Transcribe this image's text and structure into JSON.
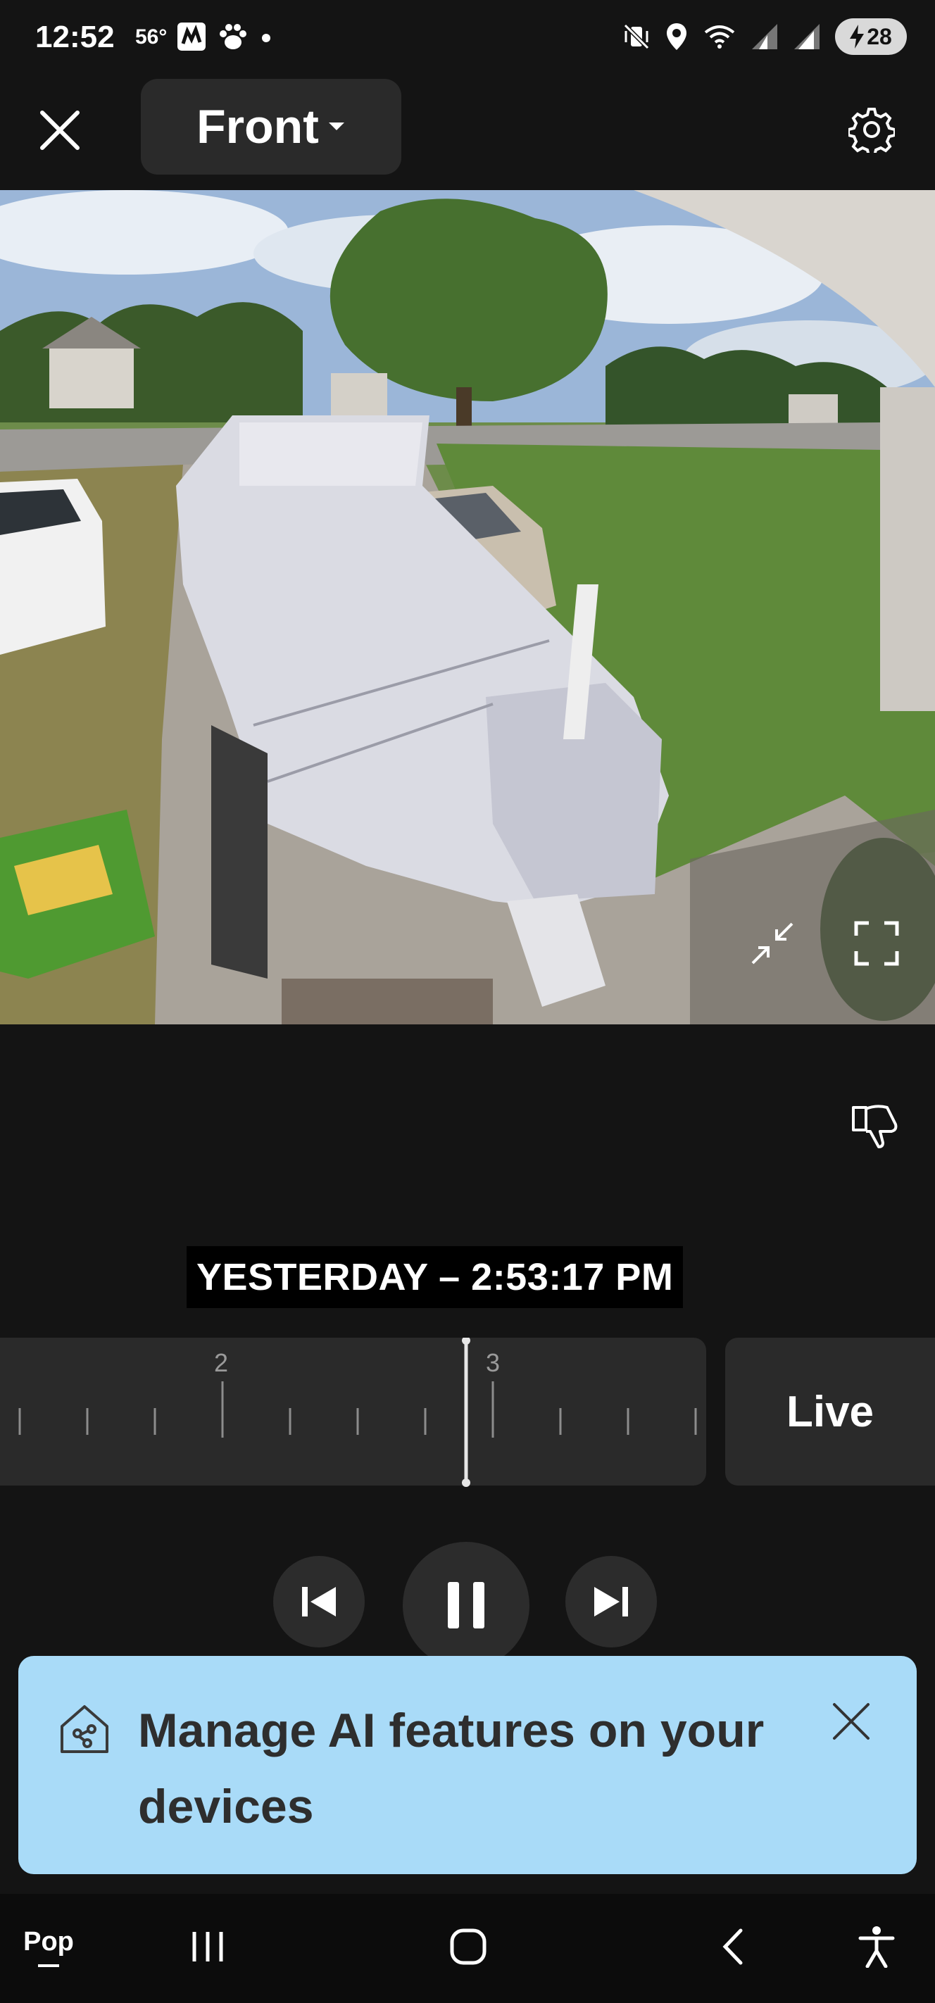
{
  "status_bar": {
    "time": "12:52",
    "temperature": "56°",
    "battery_level": "28",
    "icons": [
      "news-icon",
      "paw-icon",
      "dot-icon",
      "mute-vibrate-icon",
      "location-icon",
      "wifi-icon",
      "signal-icon",
      "signal-icon",
      "charging-icon"
    ]
  },
  "header": {
    "close_icon": "close-icon",
    "device_name": "Front",
    "dropdown_icon": "caret-down-icon",
    "settings_icon": "gear-icon"
  },
  "camera": {
    "controls": [
      "collapse-icon",
      "fullscreen-icon"
    ]
  },
  "feedback_icon": "thumbs-down-icon",
  "timestamp": "YESTERDAY – 2:53:17 PM",
  "timeline": {
    "hour_labels": [
      "2",
      "3"
    ],
    "live_label": "Live"
  },
  "playback": {
    "controls": [
      "skip-previous-icon",
      "pause-icon",
      "skip-next-icon"
    ]
  },
  "banner": {
    "text": "Manage AI features on your devices",
    "icon": "ai-home-icon",
    "close_icon": "close-icon",
    "background": "#a9dbf8"
  },
  "nav_bar": {
    "pop_label": "Pop",
    "items": [
      "recents-icon",
      "home-icon",
      "back-icon",
      "accessibility-icon"
    ]
  }
}
